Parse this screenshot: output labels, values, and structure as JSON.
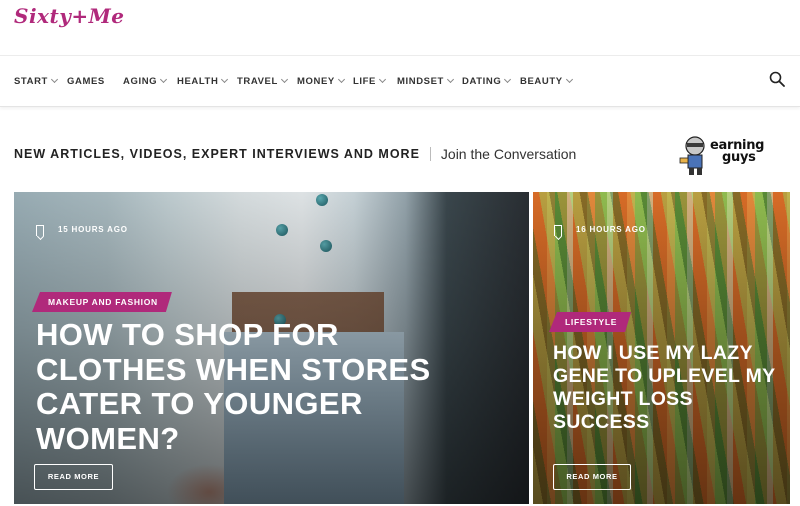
{
  "brand": {
    "logo_text": "Sixty+Me",
    "accent_color": "#b0297b"
  },
  "nav": {
    "items": [
      {
        "label": "START",
        "has_dropdown": true
      },
      {
        "label": "GAMES",
        "has_dropdown": false
      },
      {
        "label": "AGING",
        "has_dropdown": true
      },
      {
        "label": "HEALTH",
        "has_dropdown": true
      },
      {
        "label": "TRAVEL",
        "has_dropdown": true
      },
      {
        "label": "MONEY",
        "has_dropdown": true
      },
      {
        "label": "LIFE",
        "has_dropdown": true
      },
      {
        "label": "MINDSET",
        "has_dropdown": true
      },
      {
        "label": "DATING",
        "has_dropdown": true
      },
      {
        "label": "BEAUTY",
        "has_dropdown": true
      }
    ],
    "search_icon": "search-icon"
  },
  "tagline": {
    "text": "NEW ARTICLES, VIDEOS, EXPERT INTERVIEWS AND MORE",
    "link": "Join the Conversation"
  },
  "partner": {
    "line1": "earning",
    "line2": "guys"
  },
  "articles": [
    {
      "time": "15 HOURS AGO",
      "category": "MAKEUP AND FASHION",
      "title": "HOW TO SHOP FOR CLOTHES WHEN STORES CATER TO YOUNGER WOMEN?",
      "button": "READ MORE"
    },
    {
      "time": "16 HOURS AGO",
      "category": "LIFESTYLE",
      "title": "HOW I USE MY LAZY GENE TO UPLEVEL MY WEIGHT LOSS SUCCESS",
      "button": "READ MORE"
    }
  ]
}
